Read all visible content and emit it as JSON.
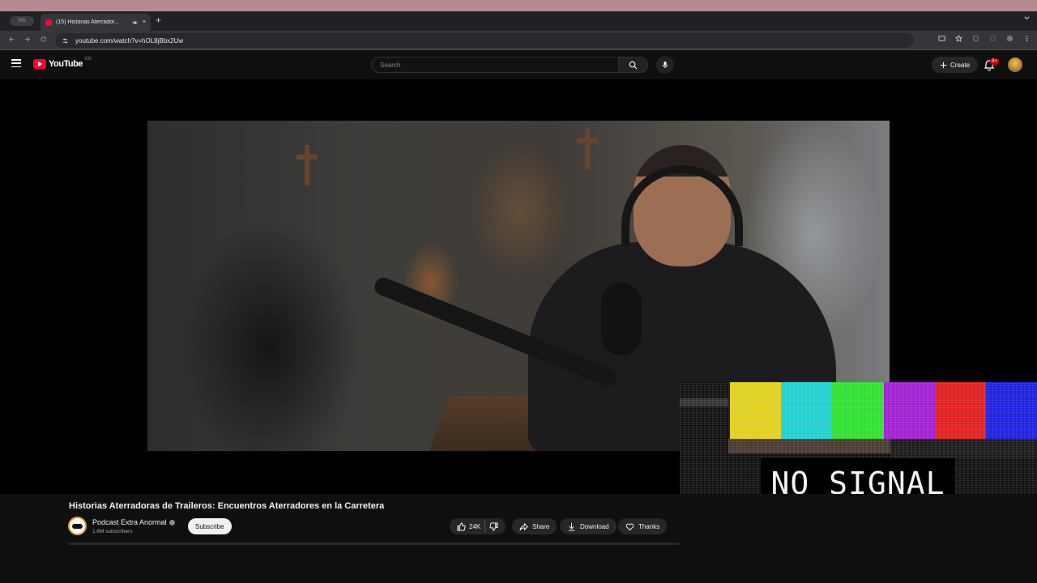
{
  "os": {
    "apple_glyph": ""
  },
  "browser": {
    "tab_group_label": "Rb",
    "active_tab_title": "(15) Historias Aterrador...",
    "url": "youtube.com/watch?v=hOL8jBbx2Uw",
    "new_tab": "+",
    "close_tab": "×"
  },
  "youtube": {
    "logo_text": "YouTube",
    "logo_region": "CO",
    "search_placeholder": "Search",
    "create_label": "Create",
    "notification_count": "9+"
  },
  "overlay": {
    "text": "NO SIGNAL"
  },
  "video": {
    "title": "Historias Aterradoras de Traileros: Encuentros Aterradores en la Carretera",
    "channel_name": "Podcast Extra Anormal",
    "subscribers": "1.6M subscribers",
    "subscribe_label": "Subscribe",
    "like_count": "24K",
    "share_label": "Share",
    "download_label": "Download",
    "thanks_label": "Thanks"
  },
  "colors": {
    "yt_red": "#ff0033",
    "yt_bg": "#0f0f0f",
    "pill_bg": "#272727",
    "mac_menubar": "#b58a92"
  },
  "color_bars": [
    "#e0d020",
    "#20d0d0",
    "#30e030",
    "#a020d0",
    "#e02020",
    "#2020e0"
  ]
}
